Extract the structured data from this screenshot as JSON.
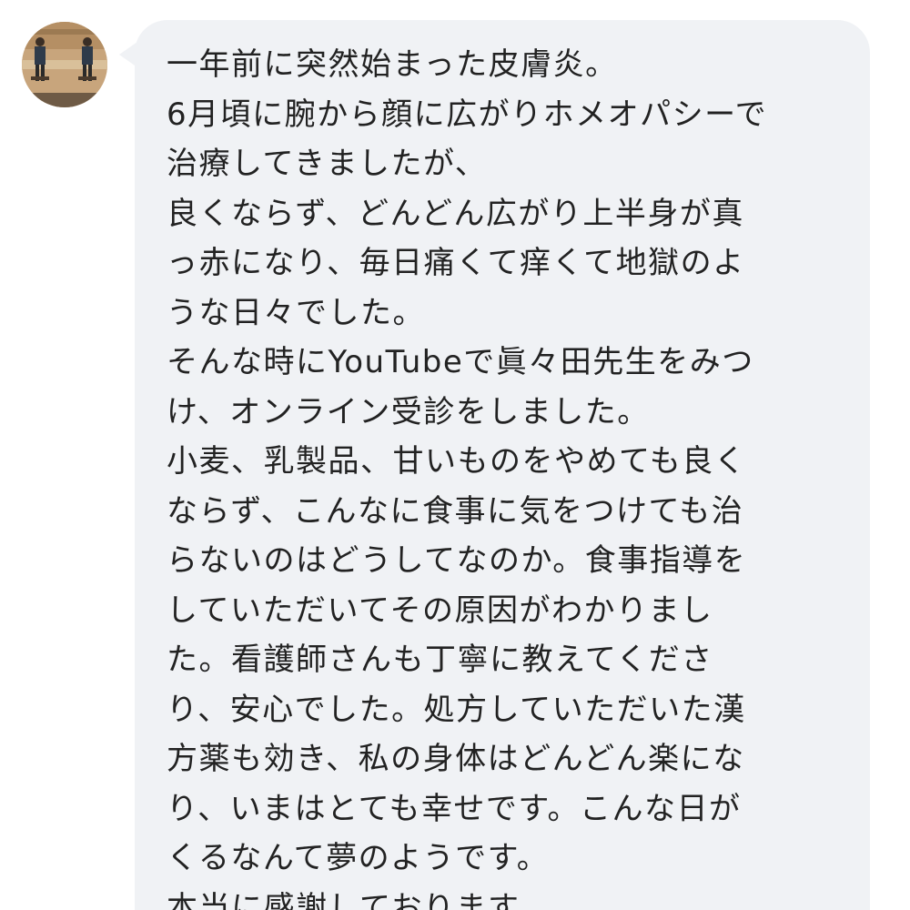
{
  "conversation": {
    "sender": {
      "avatar_icon": "profile-photo-avatar"
    },
    "message": {
      "lines": [
        "一年前に突然始まった皮膚炎。",
        "6月頃に腕から顔に広がりホメオパシーで",
        "治療してきましたが、",
        "良くならず、どんどん広がり上半身が真",
        "っ赤になり、毎日痛くて痒くて地獄のよ",
        "うな日々でした。",
        "そんな時にYouTubeで眞々田先生をみつ",
        "け、オンライン受診をしました。",
        "小麦、乳製品、甘いものをやめても良く",
        "ならず、こんなに食事に気をつけても治",
        "らないのはどうしてなのか。食事指導を",
        "していただいてその原因がわかりまし",
        "た。看護師さんも丁寧に教えてくださ",
        "り、安心でした。処方していただいた漢",
        "方薬も効き、私の身体はどんどん楽にな",
        "り、いまはとても幸せです。こんな日が",
        "くるなんて夢のようです。",
        "本当に感謝しております。"
      ]
    }
  },
  "colors": {
    "page_background": "#ffffff",
    "bubble_background": "#f0f2f5",
    "text": "#222222"
  }
}
